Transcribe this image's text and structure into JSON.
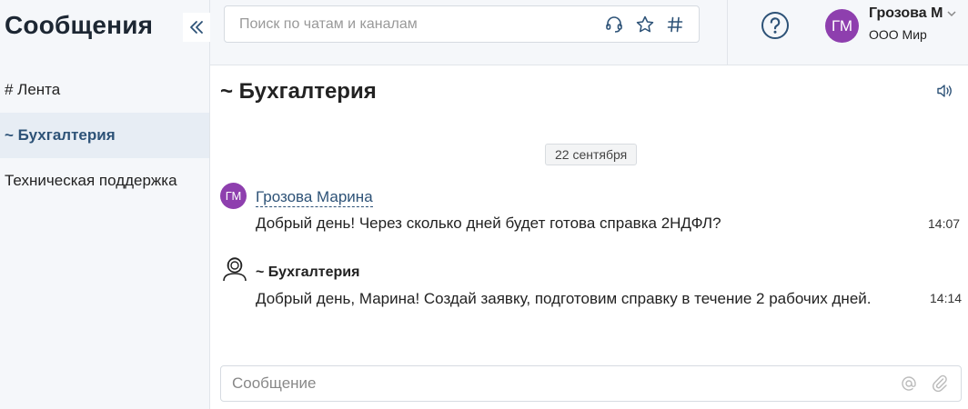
{
  "sidebar": {
    "title": "Сообщения",
    "items": [
      {
        "label": "# Лента",
        "active": false
      },
      {
        "label": "~ Бухгалтерия",
        "active": true
      },
      {
        "label": "Техническая поддержка",
        "active": false
      }
    ]
  },
  "header": {
    "search_placeholder": "Поиск по чатам и каналам",
    "search_icons": [
      "headset-icon",
      "star-icon",
      "hash-icon"
    ],
    "help_icon": "help-circle-icon",
    "user": {
      "initials": "ГМ",
      "name": "Грозова М",
      "org": "ООО Мир"
    }
  },
  "channel": {
    "title": "~ Бухгалтерия",
    "date_separator": "22 сентября",
    "messages": [
      {
        "author": "Грозова Марина",
        "initials": "ГМ",
        "text": "Добрый день! Через сколько дней будет готова справка 2НДФЛ?",
        "time": "14:07"
      },
      {
        "author": "~ Бухгалтерия",
        "text": "Добрый день, Марина! Создай заявку, подготовим справку в течение 2 рабочих дней.",
        "time": "14:14"
      }
    ]
  },
  "composer": {
    "placeholder": "Сообщение"
  },
  "colors": {
    "accent": "#2d5277",
    "avatar": "#8e3fae",
    "sidebar_bg": "#f5f7fa",
    "active_item_bg": "#e7edf4"
  }
}
